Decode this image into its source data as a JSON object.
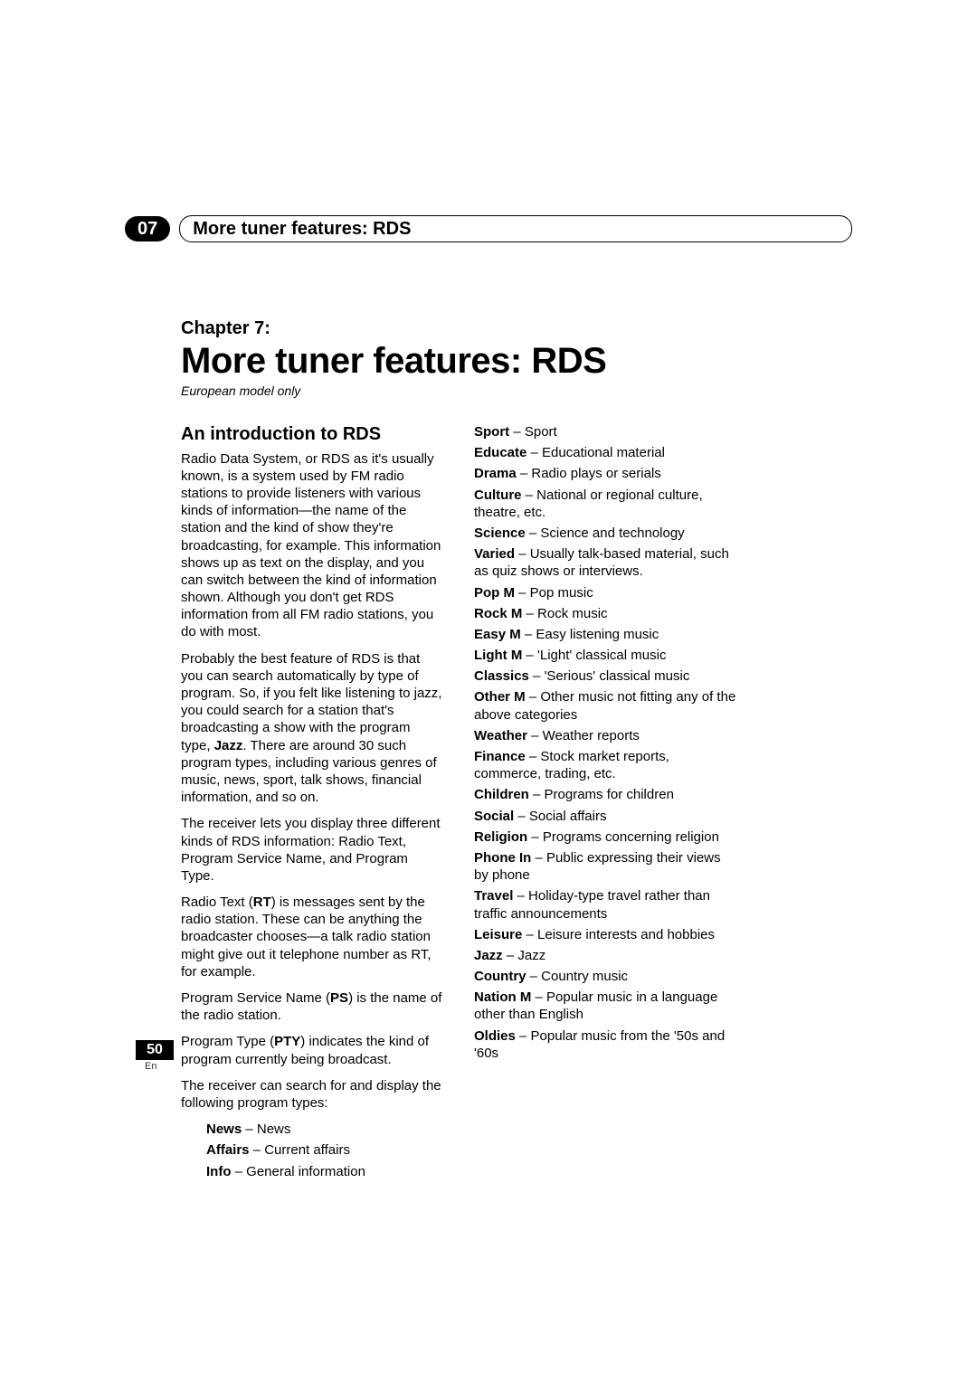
{
  "header": {
    "chapter_num": "07",
    "running_title": "More tuner features: RDS"
  },
  "chapter": {
    "label": "Chapter 7:",
    "title": "More tuner features: RDS",
    "subtitle": "European model only"
  },
  "section_heading": "An introduction to RDS",
  "paragraphs": {
    "p1": "Radio Data System, or RDS as it's usually known, is a system used by FM radio stations to provide listeners with various kinds of information—the name of the station and the kind of show they're broadcasting, for example. This information shows up as text on the display, and you can switch between the kind of information shown. Although you don't get RDS information from all FM radio stations, you do with most.",
    "p2a": "Probably the best feature of RDS is that you can search automatically by type of program. So, if you felt like listening to jazz, you could search for a station that's broadcasting a show with the program type, ",
    "p2_jazz": "Jazz",
    "p2b": ". There are around 30 such program types, including various genres of music, news, sport, talk shows, financial information, and so on.",
    "p3": "The receiver lets you display three different kinds of RDS information: Radio Text, Program Service Name, and Program Type.",
    "p4a": "Radio Text (",
    "p4_rt": "RT",
    "p4b": ") is messages sent by the radio station. These can be anything the broadcaster chooses—a talk radio station might give out it telephone number as RT, for example.",
    "p5a": "Program Service Name (",
    "p5_ps": "PS",
    "p5b": ") is the name of the radio station.",
    "p6a": "Program Type (",
    "p6_pty": "PTY",
    "p6b": ") indicates the kind of program currently being broadcast.",
    "p7": "The receiver can search for and display the following program types:"
  },
  "types_left": [
    {
      "term": "News",
      "desc": "News"
    },
    {
      "term": "Affairs",
      "desc": "Current affairs"
    },
    {
      "term": "Info",
      "desc": "General information"
    }
  ],
  "types_right": [
    {
      "term": "Sport",
      "desc": "Sport"
    },
    {
      "term": "Educate",
      "desc": "Educational material"
    },
    {
      "term": "Drama",
      "desc": "Radio plays or serials"
    },
    {
      "term": "Culture",
      "desc": "National or regional culture, theatre, etc."
    },
    {
      "term": "Science",
      "desc": "Science and technology"
    },
    {
      "term": "Varied",
      "desc": "Usually talk-based material, such as quiz shows or interviews."
    },
    {
      "term": "Pop M",
      "desc": "Pop music"
    },
    {
      "term": "Rock M",
      "desc": "Rock music"
    },
    {
      "term": "Easy M",
      "desc": " Easy listening music"
    },
    {
      "term": "Light M",
      "desc": "'Light' classical music"
    },
    {
      "term": "Classics",
      "desc": "'Serious' classical music"
    },
    {
      "term": "Other M",
      "desc": "Other music not fitting any of the above categories"
    },
    {
      "term": "Weather",
      "desc": "Weather reports"
    },
    {
      "term": "Finance",
      "desc": "Stock market reports, commerce, trading, etc."
    },
    {
      "term": "Children",
      "desc": "Programs for children"
    },
    {
      "term": "Social",
      "desc": "Social affairs"
    },
    {
      "term": "Religion",
      "desc": "Programs concerning religion"
    },
    {
      "term": "Phone In",
      "desc": "Public expressing their views by phone"
    },
    {
      "term": "Travel",
      "desc": "Holiday-type travel rather than traffic announcements"
    },
    {
      "term": "Leisure",
      "desc": "Leisure interests and hobbies"
    },
    {
      "term": "Jazz",
      "desc": "Jazz"
    },
    {
      "term": "Country",
      "desc": "Country music"
    },
    {
      "term": "Nation M",
      "desc": "Popular music in a language other than English"
    },
    {
      "term": "Oldies",
      "desc": "Popular music from the '50s and '60s"
    }
  ],
  "footer": {
    "page_num": "50",
    "lang": "En"
  }
}
